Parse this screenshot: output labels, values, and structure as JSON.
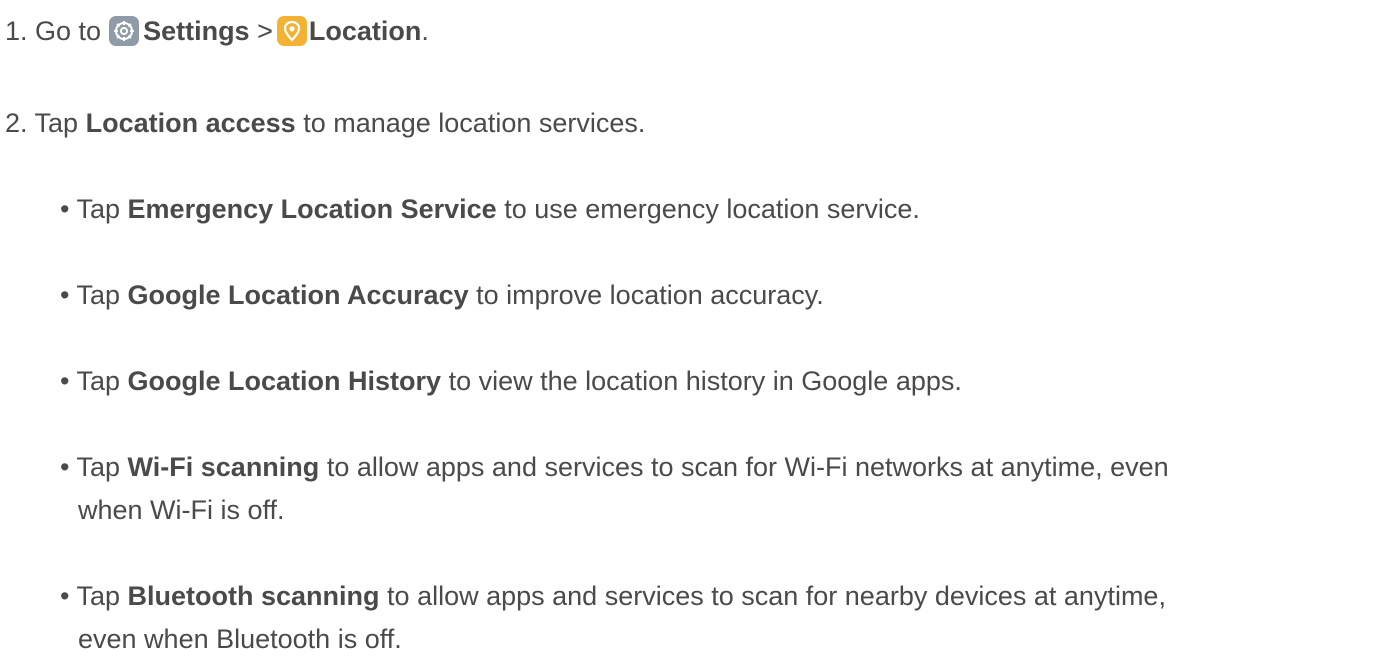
{
  "step1": {
    "prefix": "1. Go to",
    "settings_label": "Settings",
    "separator": ">",
    "location_label": "Location",
    "suffix": ".",
    "settings_icon": "settings-gear-icon",
    "location_icon": "location-pin-icon",
    "settings_icon_color": "#8f9ba6",
    "location_icon_color": "#f3b233"
  },
  "step2": {
    "prefix": "2. Tap",
    "bold": "Location access",
    "suffix": "to manage location services."
  },
  "bullets": [
    {
      "marker": "•",
      "prefix": "Tap",
      "bold": "Emergency Location Service",
      "suffix": "to use emergency location service.",
      "cont": ""
    },
    {
      "marker": "•",
      "prefix": "Tap",
      "bold": "Google Location Accuracy",
      "suffix": "to improve location accuracy.",
      "cont": ""
    },
    {
      "marker": "•",
      "prefix": "Tap",
      "bold": "Google Location History",
      "suffix": "to view the location history in Google apps.",
      "cont": ""
    },
    {
      "marker": "•",
      "prefix": "Tap",
      "bold": "Wi-Fi scanning",
      "suffix": "to allow apps and services to scan for Wi-Fi networks at anytime, even",
      "cont": "when Wi-Fi is off."
    },
    {
      "marker": "•",
      "prefix": "Tap",
      "bold": "Bluetooth scanning",
      "suffix": "to allow apps and services to scan for nearby devices at anytime,",
      "cont": "even when Bluetooth is off."
    }
  ]
}
